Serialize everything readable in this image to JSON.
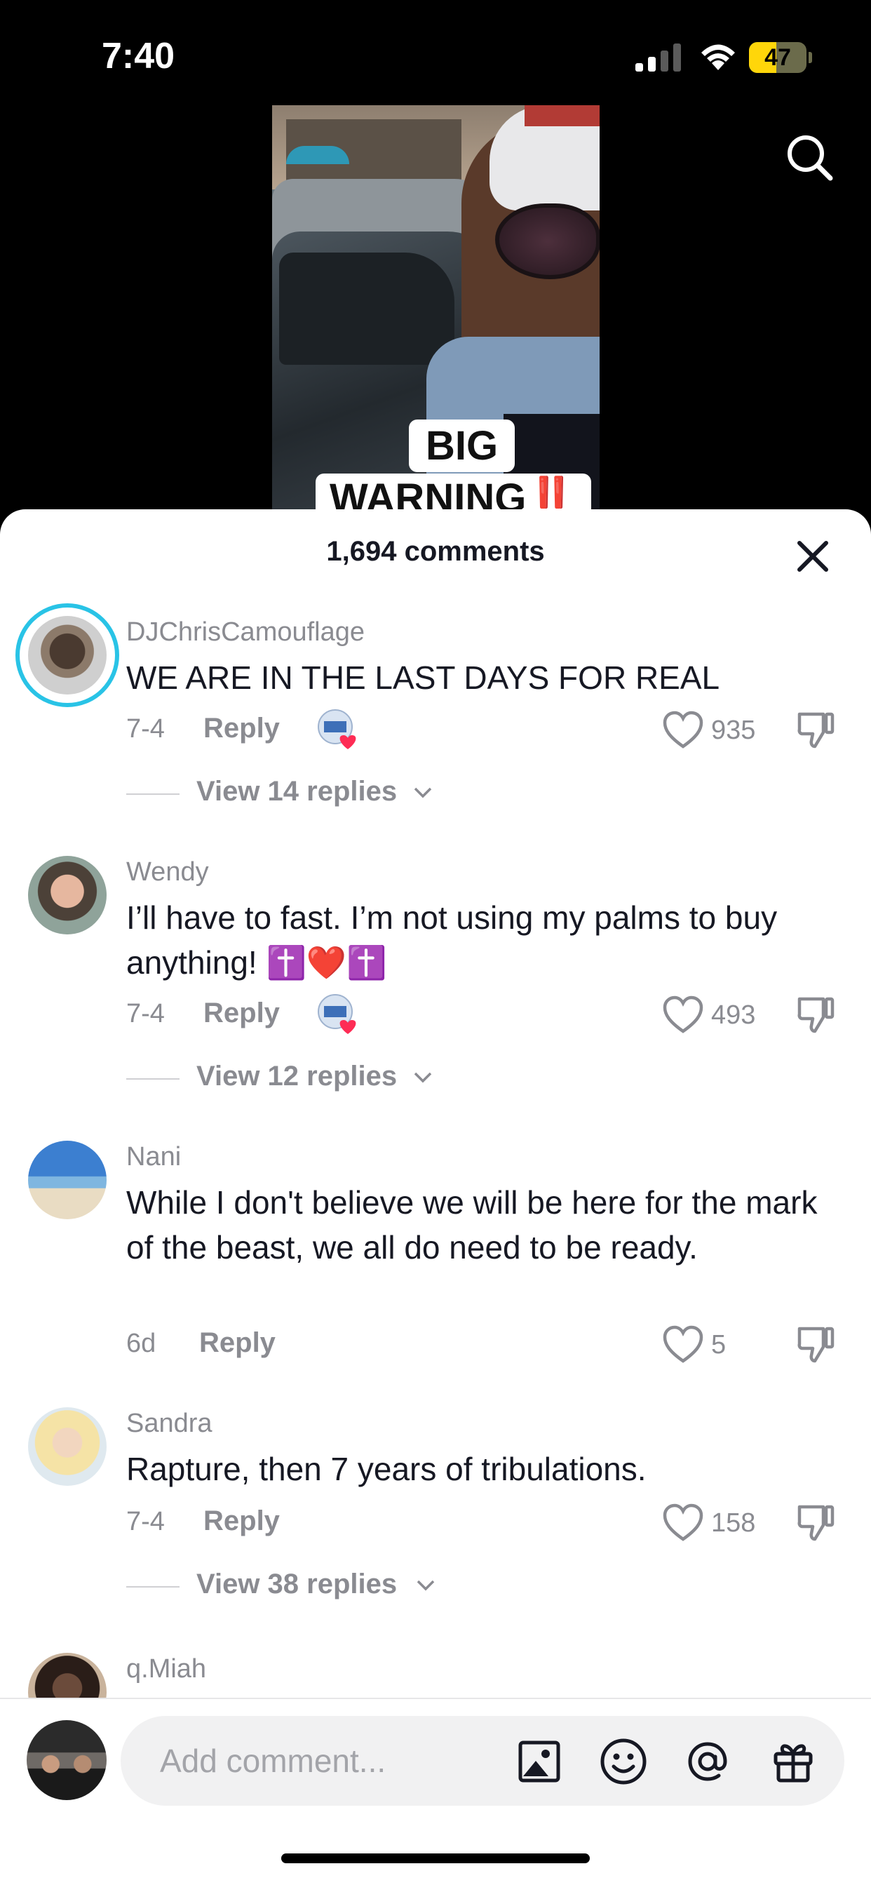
{
  "status_bar": {
    "time": "7:40",
    "battery": "47",
    "battery_level": 0.47
  },
  "video": {
    "caption_line1": "BIG",
    "caption_line2": "WARNING",
    "caption_emoji": "‼️"
  },
  "sheet": {
    "title": "1,694 comments"
  },
  "comments": [
    {
      "username": "DJChrisCamouflage",
      "text": "WE ARE IN THE LAST DAYS FOR REAL",
      "date": "7-4",
      "reply": "Reply",
      "likes": "935",
      "view_replies": "View 14 replies"
    },
    {
      "username": "Wendy",
      "text": "I’ll have to fast. I’m not using my palms to buy anything! ✝️❤️✝️",
      "date": "7-4",
      "reply": "Reply",
      "likes": "493",
      "view_replies": "View 12 replies"
    },
    {
      "username": "Nani",
      "text": "While I don't believe we will be here for the mark of the beast, we all do need to be ready.",
      "date": "6d",
      "reply": "Reply",
      "likes": "5"
    },
    {
      "username": "Sandra",
      "text": "Rapture, then 7 years of tribulations.",
      "date": "7-4",
      "reply": "Reply",
      "likes": "158",
      "view_replies": "View 38 replies"
    },
    {
      "username": "q.Miah"
    }
  ],
  "input": {
    "placeholder": "Add comment..."
  },
  "colors": {
    "ring": "#29c3e6",
    "like": "#8a8b91",
    "text": "#161823",
    "battery": "#ffd60a"
  }
}
